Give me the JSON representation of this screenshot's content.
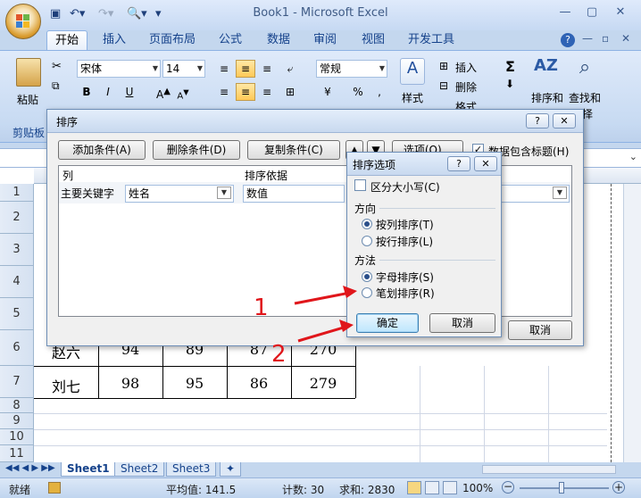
{
  "window": {
    "title": "Book1 - Microsoft Excel"
  },
  "ribbon": {
    "tabs": [
      "开始",
      "插入",
      "页面布局",
      "公式",
      "数据",
      "审阅",
      "视图",
      "开发工具"
    ],
    "font_name": "宋体",
    "font_size": "14",
    "paste_label": "粘贴",
    "clipboard_label": "剪贴板",
    "number_format": "常规",
    "style_label": "样式",
    "insert_label": "插入",
    "delete_label": "删除",
    "format_label": "格式",
    "sort_filter_label": "排序和",
    "find_select_label": "查找和",
    "select_label": "择"
  },
  "grid": {
    "rows": [
      {
        "num": "1"
      },
      {
        "num": "2"
      },
      {
        "num": "3"
      },
      {
        "num": "4"
      },
      {
        "num": "5"
      },
      {
        "num": "6"
      },
      {
        "num": "7"
      },
      {
        "num": "8"
      },
      {
        "num": "9"
      },
      {
        "num": "10"
      },
      {
        "num": "11"
      }
    ],
    "visible_data": [
      {
        "name": "赵六",
        "c1": "94",
        "c2": "89",
        "c3": "87",
        "c4": "270"
      },
      {
        "name": "刘七",
        "c1": "98",
        "c2": "95",
        "c3": "86",
        "c4": "279"
      }
    ]
  },
  "sheets": [
    "Sheet1",
    "Sheet2",
    "Sheet3"
  ],
  "status": {
    "ready": "就绪",
    "average": "平均值: 141.5",
    "count": "计数: 30",
    "sum": "求和: 2830",
    "zoom": "100%"
  },
  "sort_dialog": {
    "title": "排序",
    "add_condition": "添加条件(A)",
    "delete_condition": "删除条件(D)",
    "copy_condition": "复制条件(C)",
    "options": "选项(O)...",
    "has_header": "数据包含标题(H)",
    "col_header": "列",
    "sort_on_header": "排序依据",
    "primary_key": "主要关键字",
    "key_value": "姓名",
    "sort_on_value": "数值",
    "cancel": "取消"
  },
  "options_dialog": {
    "title": "排序选项",
    "case_sensitive": "区分大小写(C)",
    "orientation_label": "方向",
    "sort_top_to_bottom": "按列排序(T)",
    "sort_left_to_right": "按行排序(L)",
    "method_label": "方法",
    "letter_sort": "字母排序(S)",
    "stroke_sort": "笔划排序(R)",
    "ok": "确定",
    "cancel": "取消"
  },
  "annotations": {
    "step1": "1",
    "step2": "2"
  },
  "colors": {
    "annotation_red": "#e0161b",
    "ribbon_text": "#15428b"
  }
}
